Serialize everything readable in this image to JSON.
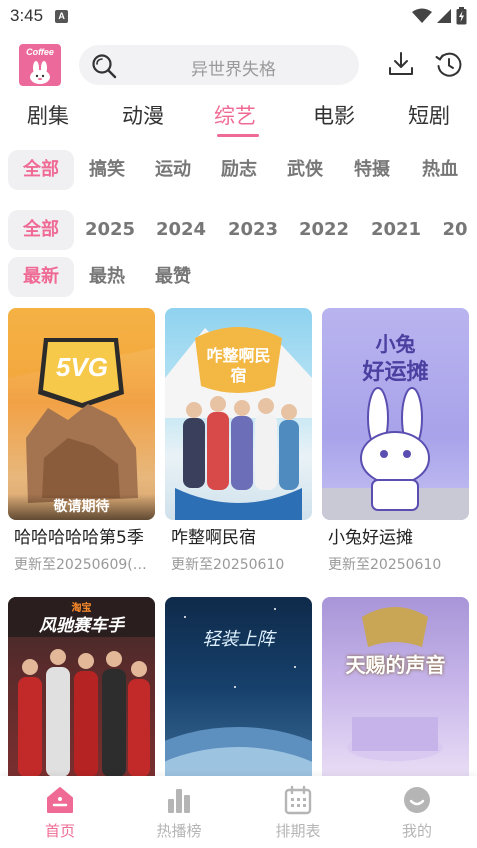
{
  "status_bar": {
    "time": "3:45",
    "notif_letter": "A"
  },
  "header": {
    "logo_text": "Coffee",
    "search_placeholder": "异世界失格"
  },
  "categories": [
    {
      "label": "剧集"
    },
    {
      "label": "动漫"
    },
    {
      "label": "综艺"
    },
    {
      "label": "电影"
    },
    {
      "label": "短剧"
    }
  ],
  "active_category": "综艺",
  "genre_filters": [
    "全部",
    "搞笑",
    "运动",
    "励志",
    "武侠",
    "特摄",
    "热血"
  ],
  "year_filters": [
    "全部",
    "2025",
    "2024",
    "2023",
    "2022",
    "2021",
    "20"
  ],
  "sort_filters": [
    "最新",
    "最热",
    "最赞"
  ],
  "cards": [
    {
      "title": "哈哈哈哈哈第5季",
      "subtitle": "更新至20250609(…",
      "badge": "敬请期待"
    },
    {
      "title": "咋整啊民宿",
      "subtitle": "更新至20250610"
    },
    {
      "title": "小兔好运摊",
      "subtitle": "更新至20250610"
    },
    {
      "title": "",
      "subtitle": ""
    },
    {
      "title": "",
      "subtitle": ""
    },
    {
      "title": "",
      "subtitle": ""
    }
  ],
  "poster_art_text": {
    "p1": "5VG",
    "p2": "咋整啊民宿",
    "p3a": "小兔",
    "p3b": "好运摊",
    "p4": "风驰赛车手",
    "p4_top": "淘宝",
    "p5": "轻装上阵",
    "p6": "天赐的声音"
  },
  "bottom_nav": [
    {
      "label": "首页",
      "icon": "home-icon"
    },
    {
      "label": "热播榜",
      "icon": "chart-icon"
    },
    {
      "label": "排期表",
      "icon": "calendar-icon"
    },
    {
      "label": "我的",
      "icon": "profile-icon"
    }
  ],
  "colors": {
    "accent": "#ef6b96",
    "inactive": "#b5b5b5",
    "chip_bg": "#f0f0f2"
  }
}
